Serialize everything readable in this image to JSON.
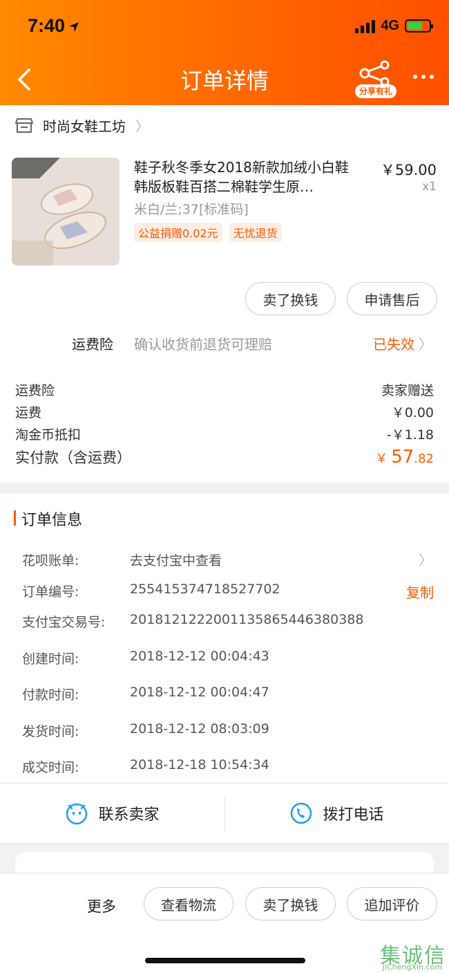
{
  "status_bar": {
    "time": "7:40",
    "network": "4G"
  },
  "header": {
    "title": "订单详情",
    "share_label": "分享有礼"
  },
  "store": {
    "name": "时尚女鞋工坊"
  },
  "product": {
    "title": "鞋子秋冬季女2018新款加绒小白鞋韩版板鞋百搭二棉鞋学生原…",
    "price": "￥59.00",
    "qty": "x1",
    "spec": "米白/兰;37[标准码]",
    "tags": [
      "公益捐赠0.02元",
      "无忧退货"
    ]
  },
  "actions": {
    "sell_label": "卖了换钱",
    "after_sale_label": "申请售后"
  },
  "insurance": {
    "title": "运费险",
    "desc": "确认收货前退货可理赔",
    "status": "已失效"
  },
  "fees": [
    {
      "label": "运费险",
      "value": "卖家赠送"
    },
    {
      "label": "运费",
      "value": "￥0.00"
    },
    {
      "label": "淘金币抵扣",
      "value": "-￥1.18"
    }
  ],
  "total": {
    "label": "实付款（含运费）",
    "currency": "￥",
    "integer": "57",
    "decimal": ".82"
  },
  "order_info": {
    "heading": "订单信息",
    "rows": [
      {
        "key": "花呗账单:",
        "value": "去支付宝中查看"
      },
      {
        "key": "订单编号:",
        "value": "255415374718527702",
        "action": "复制"
      },
      {
        "key": "支付宝交易号:",
        "value": "2018121222001135865446380388"
      },
      {
        "key": "创建时间:",
        "value": "2018-12-12 00:04:43"
      },
      {
        "key": "付款时间:",
        "value": "2018-12-12 00:04:47"
      },
      {
        "key": "发货时间:",
        "value": "2018-12-12 08:03:09"
      },
      {
        "key": "成交时间:",
        "value": "2018-12-18 10:54:34"
      }
    ]
  },
  "contact": {
    "seller_label": "联系卖家",
    "call_label": "拨打电话"
  },
  "bottom_bar": {
    "more_label": "更多",
    "buttons": [
      "查看物流",
      "卖了换钱",
      "追加评价"
    ]
  },
  "watermark": {
    "chars": "集诚信",
    "sub": "JiChengXin.com"
  },
  "colors": {
    "accent": "#ff5a00",
    "header_start": "#ff8a00",
    "header_end": "#ff4f00"
  }
}
